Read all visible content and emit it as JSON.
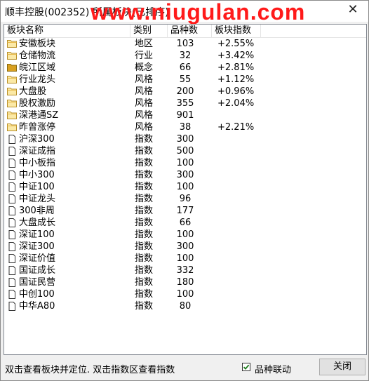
{
  "window": {
    "title": "顺丰控股(002352) 所属板块(已排序)",
    "watermark": "www.niugulan.com",
    "close_glyph": "✕"
  },
  "table": {
    "columns": [
      "板块名称",
      "类别",
      "品种数",
      "板块指数"
    ],
    "rows": [
      {
        "name": "安徽板块",
        "type": "地区",
        "count": "103",
        "index": "+2.55%",
        "icon": "folder-icon"
      },
      {
        "name": "仓储物流",
        "type": "行业",
        "count": "32",
        "index": "+3.42%",
        "icon": "folder-icon"
      },
      {
        "name": "皖江区域",
        "type": "概念",
        "count": "66",
        "index": "+2.81%",
        "icon": "folder-filled-icon"
      },
      {
        "name": "行业龙头",
        "type": "风格",
        "count": "55",
        "index": "+1.12%",
        "icon": "folder-icon"
      },
      {
        "name": "大盘股",
        "type": "风格",
        "count": "200",
        "index": "+0.96%",
        "icon": "folder-icon"
      },
      {
        "name": "股权激励",
        "type": "风格",
        "count": "355",
        "index": "+2.04%",
        "icon": "folder-icon"
      },
      {
        "name": "深港通SZ",
        "type": "风格",
        "count": "901",
        "index": "",
        "icon": "folder-icon"
      },
      {
        "name": "昨曾涨停",
        "type": "风格",
        "count": "38",
        "index": "+2.21%",
        "icon": "folder-icon"
      },
      {
        "name": "沪深300",
        "type": "指数",
        "count": "300",
        "index": "",
        "icon": "document-icon"
      },
      {
        "name": "深证成指",
        "type": "指数",
        "count": "500",
        "index": "",
        "icon": "document-icon"
      },
      {
        "name": "中小板指",
        "type": "指数",
        "count": "100",
        "index": "",
        "icon": "document-icon"
      },
      {
        "name": "中小300",
        "type": "指数",
        "count": "300",
        "index": "",
        "icon": "document-icon"
      },
      {
        "name": "中证100",
        "type": "指数",
        "count": "100",
        "index": "",
        "icon": "document-icon"
      },
      {
        "name": "中证龙头",
        "type": "指数",
        "count": "96",
        "index": "",
        "icon": "document-icon"
      },
      {
        "name": "300非周",
        "type": "指数",
        "count": "177",
        "index": "",
        "icon": "document-icon"
      },
      {
        "name": "大盘成长",
        "type": "指数",
        "count": "66",
        "index": "",
        "icon": "document-icon"
      },
      {
        "name": "深证100",
        "type": "指数",
        "count": "100",
        "index": "",
        "icon": "document-icon"
      },
      {
        "name": "深证300",
        "type": "指数",
        "count": "300",
        "index": "",
        "icon": "document-icon"
      },
      {
        "name": "深证价值",
        "type": "指数",
        "count": "100",
        "index": "",
        "icon": "document-icon"
      },
      {
        "name": "国证成长",
        "type": "指数",
        "count": "332",
        "index": "",
        "icon": "document-icon"
      },
      {
        "name": "国证民营",
        "type": "指数",
        "count": "180",
        "index": "",
        "icon": "document-icon"
      },
      {
        "name": "中创100",
        "type": "指数",
        "count": "100",
        "index": "",
        "icon": "document-icon"
      },
      {
        "name": "中华A80",
        "type": "指数",
        "count": "80",
        "index": "",
        "icon": "document-icon"
      }
    ]
  },
  "footer": {
    "hint": "双击查看板块并定位. 双击指数区查看指数",
    "checkbox_label": "品种联动",
    "checkbox_checked": true,
    "check_glyph": "✓",
    "close_button": "关闭"
  },
  "colors": {
    "watermark": "#ff1a1a",
    "folder": "#e8b94a",
    "folder_filled": "#d9a020",
    "checkmark": "#1a7a1a"
  }
}
